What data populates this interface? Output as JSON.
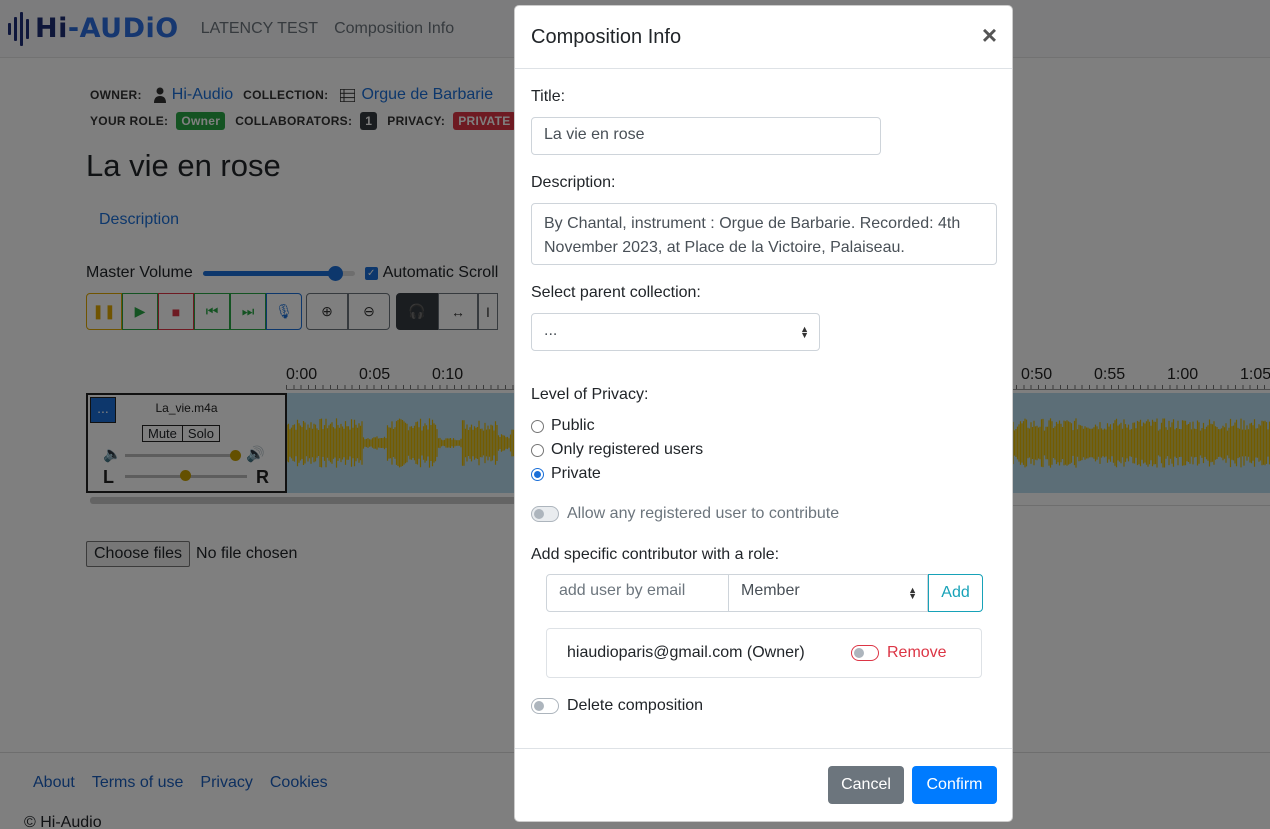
{
  "navbar": {
    "logo": {
      "hi": "Hi",
      "dash": "-",
      "audio": "AUDiO"
    },
    "links": [
      "LATENCY TEST",
      "Composition Info"
    ]
  },
  "meta": {
    "owner_label": "OWNER:",
    "owner_name": "Hi-Audio",
    "collection_label": "COLLECTION:",
    "collection_name": "Orgue de Barbarie",
    "role_label": "YOUR ROLE:",
    "role_badge": "Owner",
    "collaborators_label": "COLLABORATORS:",
    "collaborators_count": "1",
    "privacy_label": "PRIVACY:",
    "privacy_badge": "PRIVATE"
  },
  "composition": {
    "title": "La vie en rose",
    "description_tab": "Description"
  },
  "player": {
    "master_volume_label": "Master Volume",
    "master_volume_value": 0.87,
    "auto_scroll_label": "Automatic Scroll",
    "auto_scroll_checked": true,
    "timeline_labels": [
      "0:00",
      "0:05",
      "0:10",
      "0:50",
      "0:55",
      "1:00",
      "1:05"
    ]
  },
  "track": {
    "menu_label": "...",
    "name": "La_vie.m4a",
    "mute_label": "Mute",
    "solo_label": "Solo",
    "volume_value": 0.9,
    "pan_left": "L",
    "pan_right": "R",
    "wave_color": "#e6b800",
    "wave_bg": "#b8dcef"
  },
  "file_input": {
    "button": "Choose files",
    "status": "No file chosen"
  },
  "footer": {
    "links": [
      "About",
      "Terms of use",
      "Privacy",
      "Cookies"
    ],
    "copyright": "© Hi-Audio"
  },
  "modal": {
    "title": "Composition Info",
    "close": "×",
    "title_label": "Title:",
    "title_value": "La vie en rose",
    "description_label": "Description:",
    "description_value": "By Chantal, instrument : Orgue de Barbarie. Recorded: 4th November 2023, at Place de la Victoire, Palaiseau.",
    "parent_collection_label": "Select parent collection:",
    "parent_collection_value": "...",
    "privacy_label": "Level of Privacy:",
    "privacy_options": [
      "Public",
      "Only registered users",
      "Private"
    ],
    "privacy_selected": "Private",
    "allow_contribute_label": "Allow any registered user to contribute",
    "add_contributor_label": "Add specific contributor with a role:",
    "add_user_placeholder": "add user by email",
    "role_value": "Member",
    "add_button": "Add",
    "contributor_email": "hiaudioparis@gmail.com (Owner)",
    "remove_label": "Remove",
    "delete_label": "Delete composition",
    "cancel_button": "Cancel",
    "confirm_button": "Confirm"
  },
  "colors": {
    "primary": "#007bff",
    "danger": "#dc3545",
    "info": "#17a2b8",
    "secondary": "#6c757d"
  }
}
